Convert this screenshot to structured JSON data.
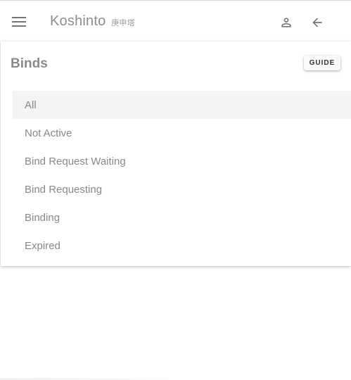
{
  "header": {
    "title": "Koshinto",
    "subtitle": "庚申塔",
    "icons": {
      "menu": "menu-icon",
      "user": "person-icon",
      "back": "arrow-back-icon"
    }
  },
  "binds": {
    "title": "Binds",
    "guide_label": "GUIDE",
    "selected": "All",
    "filters": [
      "All",
      "Not Active",
      "Bind Request Waiting",
      "Bind Requesting",
      "Binding",
      "Expired"
    ]
  },
  "colors": {
    "icon": "#757575",
    "title": "#8d8d8d",
    "selected_row": "#f4f4f4",
    "item_text": "#888888"
  }
}
